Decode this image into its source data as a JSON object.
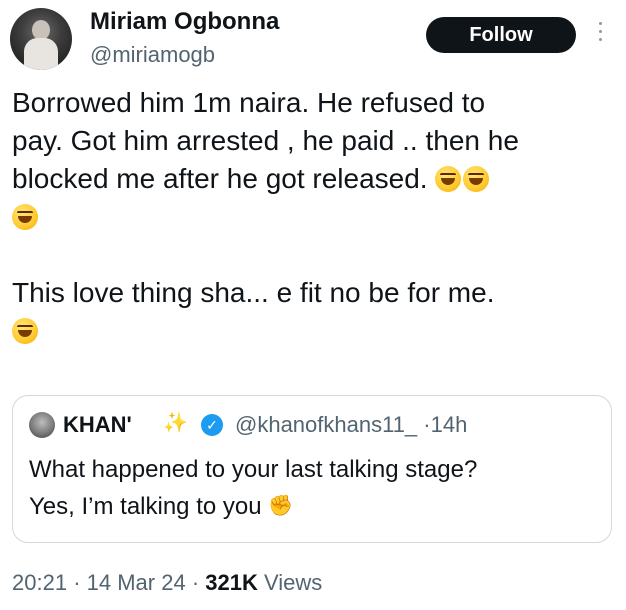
{
  "author": {
    "name": "Miriam Ogbonna",
    "handle": "@miriamogb",
    "avatar_icon": "profile-photo"
  },
  "actions": {
    "follow_label": "Follow",
    "more_icon": "vertical-ellipsis-icon"
  },
  "tweet": {
    "line1": "Borrowed him 1m naira. He refused to",
    "line2": "pay. Got him arrested , he paid .. then he",
    "line3": "blocked me after he got released.",
    "line5": "This love thing sha... e fit no be for me.",
    "emoji_icon": "rolling-on-floor-laughing-emoji"
  },
  "quoted_tweet": {
    "name": "KHAN'",
    "name_badge_icon": "sparkles-emoji",
    "verified_icon": "verified-badge-icon",
    "handle": "@khanofkhans11_",
    "separator": "·",
    "time": "14h",
    "line1": "What happened to your last talking stage?",
    "line2": "Yes, I’m talking to you",
    "end_icon": "fist-emoji"
  },
  "meta": {
    "time": "20:21",
    "sep1": "·",
    "date": "14 Mar 24",
    "sep2": "·",
    "views_count": "321K",
    "views_label": "Views"
  },
  "colors": {
    "text": "#0f1419",
    "secondary": "#536471",
    "follow_bg": "#0f1419",
    "verified": "#1d9bf0",
    "border": "#cfd9de"
  }
}
